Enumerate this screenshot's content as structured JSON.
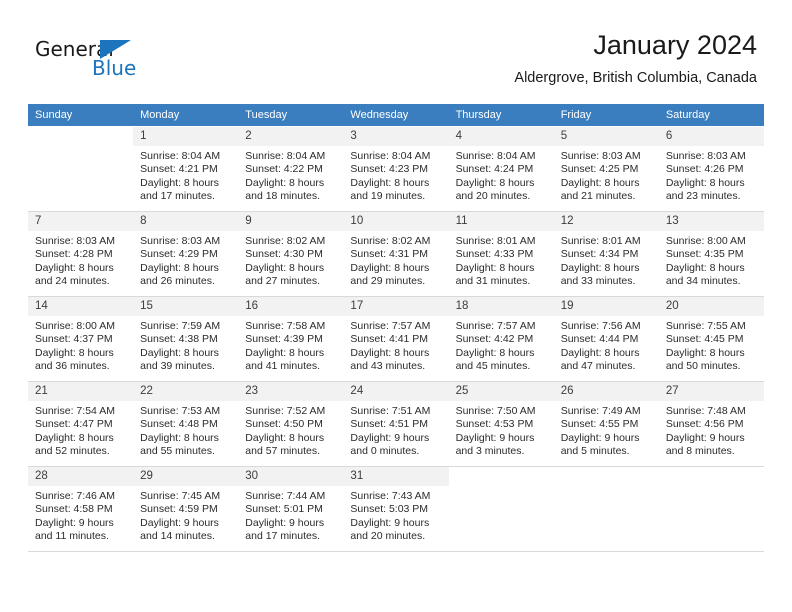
{
  "brand": {
    "name_part1": "General",
    "name_part2": "Blue",
    "accent_color": "#1c74bc"
  },
  "header": {
    "month_title": "January 2024",
    "location": "Aldergrove, British Columbia, Canada"
  },
  "calendar": {
    "header_bg": "#3a7ebf",
    "weekdays": [
      "Sunday",
      "Monday",
      "Tuesday",
      "Wednesday",
      "Thursday",
      "Friday",
      "Saturday"
    ],
    "weeks": [
      [
        {
          "day": "",
          "blank": true
        },
        {
          "day": "1",
          "sunrise": "Sunrise: 8:04 AM",
          "sunset": "Sunset: 4:21 PM",
          "daylight1": "Daylight: 8 hours",
          "daylight2": "and 17 minutes."
        },
        {
          "day": "2",
          "sunrise": "Sunrise: 8:04 AM",
          "sunset": "Sunset: 4:22 PM",
          "daylight1": "Daylight: 8 hours",
          "daylight2": "and 18 minutes."
        },
        {
          "day": "3",
          "sunrise": "Sunrise: 8:04 AM",
          "sunset": "Sunset: 4:23 PM",
          "daylight1": "Daylight: 8 hours",
          "daylight2": "and 19 minutes."
        },
        {
          "day": "4",
          "sunrise": "Sunrise: 8:04 AM",
          "sunset": "Sunset: 4:24 PM",
          "daylight1": "Daylight: 8 hours",
          "daylight2": "and 20 minutes."
        },
        {
          "day": "5",
          "sunrise": "Sunrise: 8:03 AM",
          "sunset": "Sunset: 4:25 PM",
          "daylight1": "Daylight: 8 hours",
          "daylight2": "and 21 minutes."
        },
        {
          "day": "6",
          "sunrise": "Sunrise: 8:03 AM",
          "sunset": "Sunset: 4:26 PM",
          "daylight1": "Daylight: 8 hours",
          "daylight2": "and 23 minutes."
        }
      ],
      [
        {
          "day": "7",
          "sunrise": "Sunrise: 8:03 AM",
          "sunset": "Sunset: 4:28 PM",
          "daylight1": "Daylight: 8 hours",
          "daylight2": "and 24 minutes."
        },
        {
          "day": "8",
          "sunrise": "Sunrise: 8:03 AM",
          "sunset": "Sunset: 4:29 PM",
          "daylight1": "Daylight: 8 hours",
          "daylight2": "and 26 minutes."
        },
        {
          "day": "9",
          "sunrise": "Sunrise: 8:02 AM",
          "sunset": "Sunset: 4:30 PM",
          "daylight1": "Daylight: 8 hours",
          "daylight2": "and 27 minutes."
        },
        {
          "day": "10",
          "sunrise": "Sunrise: 8:02 AM",
          "sunset": "Sunset: 4:31 PM",
          "daylight1": "Daylight: 8 hours",
          "daylight2": "and 29 minutes."
        },
        {
          "day": "11",
          "sunrise": "Sunrise: 8:01 AM",
          "sunset": "Sunset: 4:33 PM",
          "daylight1": "Daylight: 8 hours",
          "daylight2": "and 31 minutes."
        },
        {
          "day": "12",
          "sunrise": "Sunrise: 8:01 AM",
          "sunset": "Sunset: 4:34 PM",
          "daylight1": "Daylight: 8 hours",
          "daylight2": "and 33 minutes."
        },
        {
          "day": "13",
          "sunrise": "Sunrise: 8:00 AM",
          "sunset": "Sunset: 4:35 PM",
          "daylight1": "Daylight: 8 hours",
          "daylight2": "and 34 minutes."
        }
      ],
      [
        {
          "day": "14",
          "sunrise": "Sunrise: 8:00 AM",
          "sunset": "Sunset: 4:37 PM",
          "daylight1": "Daylight: 8 hours",
          "daylight2": "and 36 minutes."
        },
        {
          "day": "15",
          "sunrise": "Sunrise: 7:59 AM",
          "sunset": "Sunset: 4:38 PM",
          "daylight1": "Daylight: 8 hours",
          "daylight2": "and 39 minutes."
        },
        {
          "day": "16",
          "sunrise": "Sunrise: 7:58 AM",
          "sunset": "Sunset: 4:39 PM",
          "daylight1": "Daylight: 8 hours",
          "daylight2": "and 41 minutes."
        },
        {
          "day": "17",
          "sunrise": "Sunrise: 7:57 AM",
          "sunset": "Sunset: 4:41 PM",
          "daylight1": "Daylight: 8 hours",
          "daylight2": "and 43 minutes."
        },
        {
          "day": "18",
          "sunrise": "Sunrise: 7:57 AM",
          "sunset": "Sunset: 4:42 PM",
          "daylight1": "Daylight: 8 hours",
          "daylight2": "and 45 minutes."
        },
        {
          "day": "19",
          "sunrise": "Sunrise: 7:56 AM",
          "sunset": "Sunset: 4:44 PM",
          "daylight1": "Daylight: 8 hours",
          "daylight2": "and 47 minutes."
        },
        {
          "day": "20",
          "sunrise": "Sunrise: 7:55 AM",
          "sunset": "Sunset: 4:45 PM",
          "daylight1": "Daylight: 8 hours",
          "daylight2": "and 50 minutes."
        }
      ],
      [
        {
          "day": "21",
          "sunrise": "Sunrise: 7:54 AM",
          "sunset": "Sunset: 4:47 PM",
          "daylight1": "Daylight: 8 hours",
          "daylight2": "and 52 minutes."
        },
        {
          "day": "22",
          "sunrise": "Sunrise: 7:53 AM",
          "sunset": "Sunset: 4:48 PM",
          "daylight1": "Daylight: 8 hours",
          "daylight2": "and 55 minutes."
        },
        {
          "day": "23",
          "sunrise": "Sunrise: 7:52 AM",
          "sunset": "Sunset: 4:50 PM",
          "daylight1": "Daylight: 8 hours",
          "daylight2": "and 57 minutes."
        },
        {
          "day": "24",
          "sunrise": "Sunrise: 7:51 AM",
          "sunset": "Sunset: 4:51 PM",
          "daylight1": "Daylight: 9 hours",
          "daylight2": "and 0 minutes."
        },
        {
          "day": "25",
          "sunrise": "Sunrise: 7:50 AM",
          "sunset": "Sunset: 4:53 PM",
          "daylight1": "Daylight: 9 hours",
          "daylight2": "and 3 minutes."
        },
        {
          "day": "26",
          "sunrise": "Sunrise: 7:49 AM",
          "sunset": "Sunset: 4:55 PM",
          "daylight1": "Daylight: 9 hours",
          "daylight2": "and 5 minutes."
        },
        {
          "day": "27",
          "sunrise": "Sunrise: 7:48 AM",
          "sunset": "Sunset: 4:56 PM",
          "daylight1": "Daylight: 9 hours",
          "daylight2": "and 8 minutes."
        }
      ],
      [
        {
          "day": "28",
          "sunrise": "Sunrise: 7:46 AM",
          "sunset": "Sunset: 4:58 PM",
          "daylight1": "Daylight: 9 hours",
          "daylight2": "and 11 minutes."
        },
        {
          "day": "29",
          "sunrise": "Sunrise: 7:45 AM",
          "sunset": "Sunset: 4:59 PM",
          "daylight1": "Daylight: 9 hours",
          "daylight2": "and 14 minutes."
        },
        {
          "day": "30",
          "sunrise": "Sunrise: 7:44 AM",
          "sunset": "Sunset: 5:01 PM",
          "daylight1": "Daylight: 9 hours",
          "daylight2": "and 17 minutes."
        },
        {
          "day": "31",
          "sunrise": "Sunrise: 7:43 AM",
          "sunset": "Sunset: 5:03 PM",
          "daylight1": "Daylight: 9 hours",
          "daylight2": "and 20 minutes."
        },
        {
          "day": "",
          "blank": true
        },
        {
          "day": "",
          "blank": true
        },
        {
          "day": "",
          "blank": true
        }
      ]
    ]
  }
}
